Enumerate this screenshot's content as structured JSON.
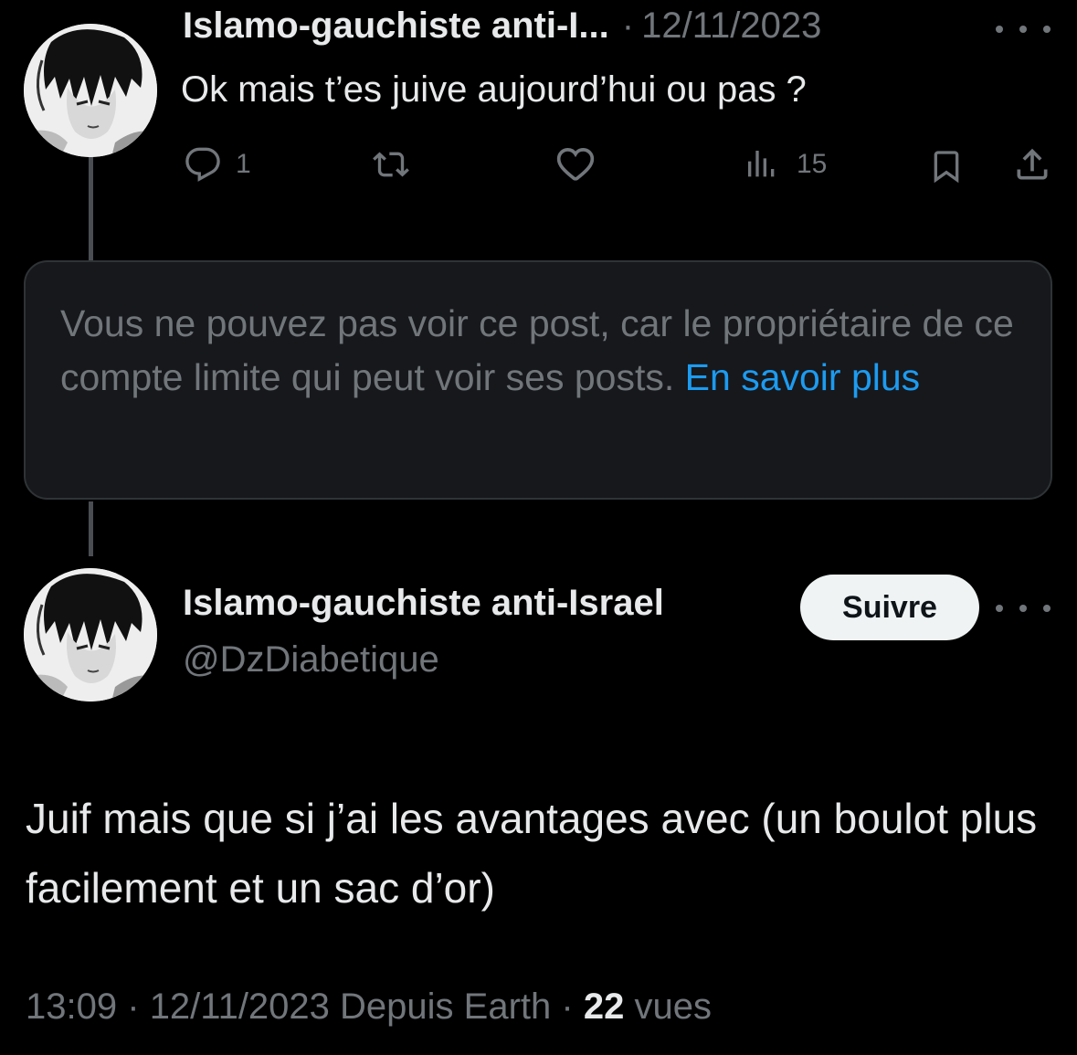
{
  "reply_tweet": {
    "display_name": "Islamo-gauchiste anti-I...",
    "separator": "·",
    "date": "12/11/2023",
    "text": "Ok mais t’es juive aujourd’hui ou pas ?",
    "actions": {
      "reply_count": "1",
      "retweet_count": "",
      "like_count": "",
      "views_count": "15"
    }
  },
  "restricted_notice": {
    "text": "Vous ne pouvez pas voir ce post, car le propriétaire de ce compte limite qui peut voir ses posts.",
    "link": "En savoir plus"
  },
  "main_tweet": {
    "display_name": "Islamo-gauchiste anti-Israel",
    "handle": "@DzDiabetique",
    "follow_label": "Suivre",
    "text": "Juif mais que si j’ai les avantages avec (un boulot plus facilement et un sac d’or)",
    "time": "13:09",
    "separator": "·",
    "date": "12/11/2023",
    "source": "Depuis Earth",
    "views_count": "22",
    "views_label": "vues"
  },
  "icons": [
    "reply-icon",
    "retweet-icon",
    "like-icon",
    "views-icon",
    "bookmark-icon",
    "share-icon",
    "more-icon"
  ]
}
